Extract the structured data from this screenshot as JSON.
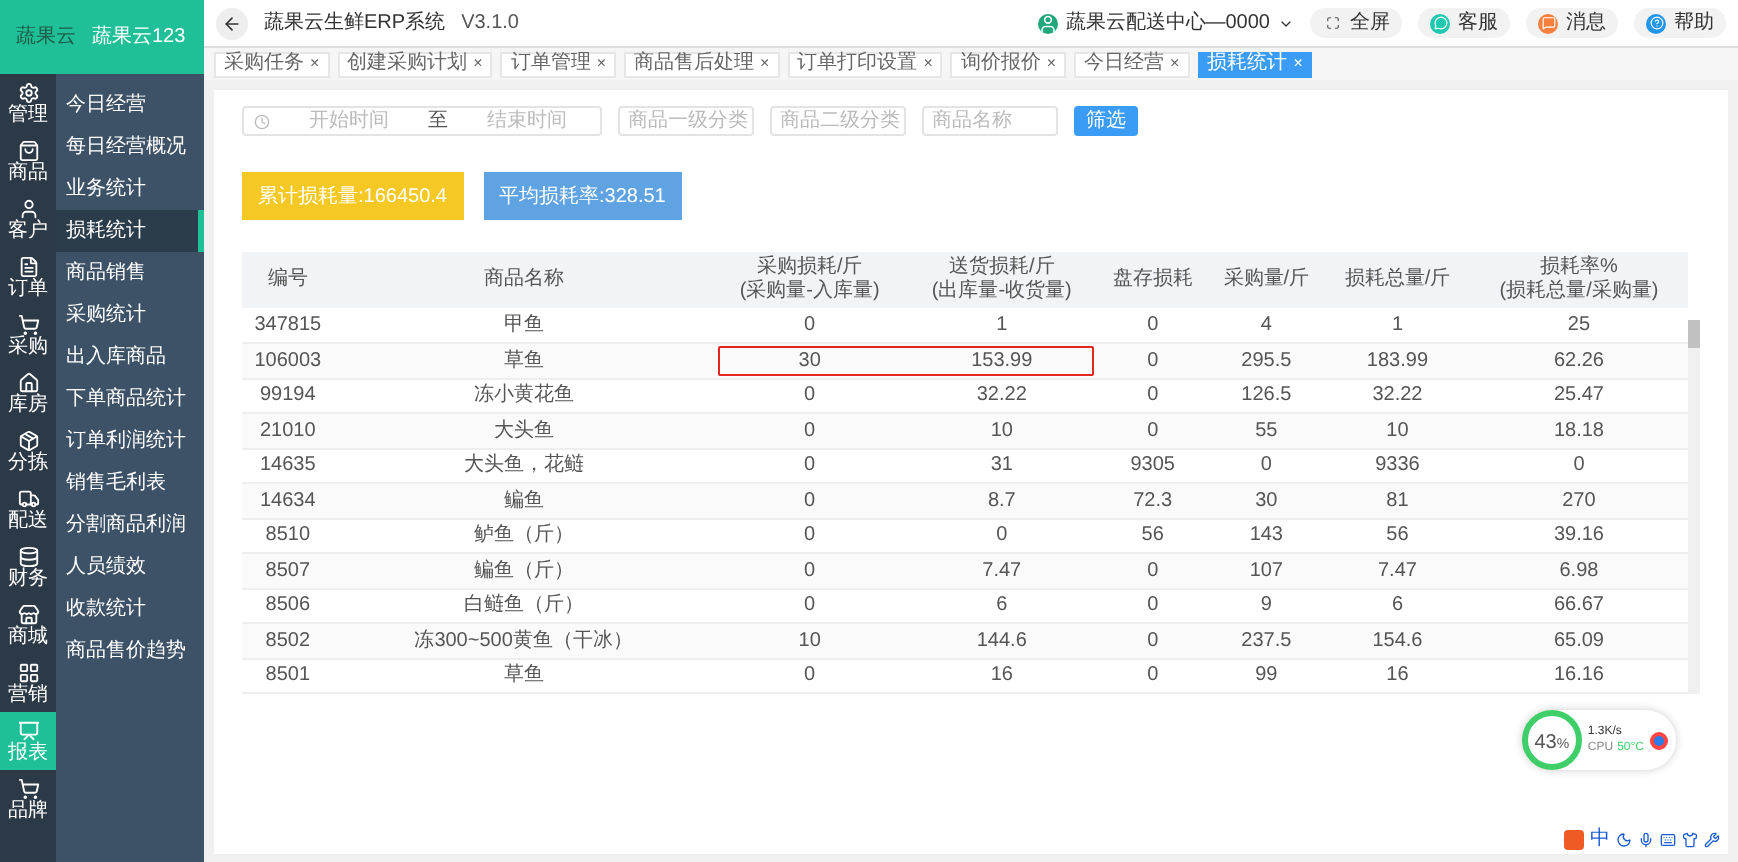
{
  "brand": {
    "logo_text": "蔬果云",
    "name": "蔬果云123"
  },
  "app_title": "蔬果云生鲜ERP系统",
  "version": "V3.1.0",
  "user": {
    "name": "蔬果云配送中心—0000"
  },
  "top_buttons": [
    {
      "label": "全屏"
    },
    {
      "label": "客服"
    },
    {
      "label": "消息"
    },
    {
      "label": "帮助"
    }
  ],
  "rail": [
    {
      "label": "管理",
      "selected": false
    },
    {
      "label": "商品",
      "selected": false
    },
    {
      "label": "客户",
      "selected": false
    },
    {
      "label": "订单",
      "selected": false
    },
    {
      "label": "采购",
      "selected": false
    },
    {
      "label": "库房",
      "selected": false
    },
    {
      "label": "分拣",
      "selected": false
    },
    {
      "label": "配送",
      "selected": false
    },
    {
      "label": "财务",
      "selected": false
    },
    {
      "label": "商城",
      "selected": false
    },
    {
      "label": "营销",
      "selected": false
    },
    {
      "label": "报表",
      "selected": true
    },
    {
      "label": "品牌",
      "selected": false
    }
  ],
  "submenu": [
    {
      "label": "今日经营",
      "selected": false
    },
    {
      "label": "每日经营概况",
      "selected": false
    },
    {
      "label": "业务统计",
      "selected": false
    },
    {
      "label": "损耗统计",
      "selected": true
    },
    {
      "label": "商品销售",
      "selected": false
    },
    {
      "label": "采购统计",
      "selected": false
    },
    {
      "label": "出入库商品",
      "selected": false
    },
    {
      "label": "下单商品统计",
      "selected": false
    },
    {
      "label": "订单利润统计",
      "selected": false
    },
    {
      "label": "销售毛利表",
      "selected": false
    },
    {
      "label": "分割商品利润",
      "selected": false
    },
    {
      "label": "人员绩效",
      "selected": false
    },
    {
      "label": "收款统计",
      "selected": false
    },
    {
      "label": "商品售价趋势",
      "selected": false
    }
  ],
  "tab_close_glyph": "×",
  "tabs": [
    {
      "label": "采购任务",
      "selected": false
    },
    {
      "label": "创建采购计划",
      "selected": false
    },
    {
      "label": "订单管理",
      "selected": false
    },
    {
      "label": "商品售后处理",
      "selected": false
    },
    {
      "label": "订单打印设置",
      "selected": false
    },
    {
      "label": "询价报价",
      "selected": false
    },
    {
      "label": "今日经营",
      "selected": false
    },
    {
      "label": "损耗统计",
      "selected": true
    }
  ],
  "filters": {
    "start_placeholder": "开始时间",
    "range_separator": "至",
    "end_placeholder": "结束时间",
    "category1_placeholder": "商品一级分类",
    "category2_placeholder": "商品二级分类",
    "name_placeholder": "商品名称",
    "button": "筛选"
  },
  "stats": [
    {
      "label": "累计损耗量:166450.4",
      "color": "#f6c824"
    },
    {
      "label": "平均损耗率:328.51",
      "color": "#5fa3e3"
    }
  ],
  "table": {
    "columns": [
      {
        "title": "编号"
      },
      {
        "title": "商品名称"
      },
      {
        "title": "采购损耗/斤",
        "subtitle": "(采购量-入库量)"
      },
      {
        "title": "送货损耗/斤",
        "subtitle": "(出库量-收货量)"
      },
      {
        "title": "盘存损耗"
      },
      {
        "title": "采购量/斤"
      },
      {
        "title": "损耗总量/斤"
      },
      {
        "title": "损耗率%",
        "subtitle": "(损耗总量/采购量)"
      }
    ],
    "rows": [
      {
        "marked": false,
        "cells": [
          "347815",
          "甲鱼",
          "0",
          "1",
          "0",
          "4",
          "1",
          "25"
        ]
      },
      {
        "marked": true,
        "cells": [
          "106003",
          "草鱼",
          "30",
          "153.99",
          "0",
          "295.5",
          "183.99",
          "62.26"
        ]
      },
      {
        "marked": false,
        "cells": [
          "99194",
          "冻小黄花鱼",
          "0",
          "32.22",
          "0",
          "126.5",
          "32.22",
          "25.47"
        ]
      },
      {
        "marked": false,
        "cells": [
          "21010",
          "大头鱼",
          "0",
          "10",
          "0",
          "55",
          "10",
          "18.18"
        ]
      },
      {
        "marked": false,
        "cells": [
          "14635",
          "大头鱼，花鲢",
          "0",
          "31",
          "9305",
          "0",
          "9336",
          "0"
        ]
      },
      {
        "marked": false,
        "cells": [
          "14634",
          "鳊鱼",
          "0",
          "8.7",
          "72.3",
          "30",
          "81",
          "270"
        ]
      },
      {
        "marked": false,
        "cells": [
          "8510",
          "鲈鱼（斤）",
          "0",
          "0",
          "56",
          "143",
          "56",
          "39.16"
        ]
      },
      {
        "marked": false,
        "cells": [
          "8507",
          "鳊鱼（斤）",
          "0",
          "7.47",
          "0",
          "107",
          "7.47",
          "6.98"
        ]
      },
      {
        "marked": false,
        "cells": [
          "8506",
          "白鲢鱼（斤）",
          "0",
          "6",
          "0",
          "9",
          "6",
          "66.67"
        ]
      },
      {
        "marked": false,
        "cells": [
          "8502",
          "冻300~500黄鱼（干冰）",
          "10",
          "144.6",
          "0",
          "237.5",
          "154.6",
          "65.09"
        ]
      },
      {
        "marked": false,
        "cells": [
          "8501",
          "草鱼",
          "0",
          "16",
          "0",
          "99",
          "16",
          "16.16"
        ]
      }
    ]
  },
  "monitor": {
    "percent": "43",
    "unit": "%",
    "speed": "1.3K/s",
    "cpu_label": "CPU",
    "cpu_temp": "50°C"
  },
  "ime": {
    "mode": "中"
  }
}
